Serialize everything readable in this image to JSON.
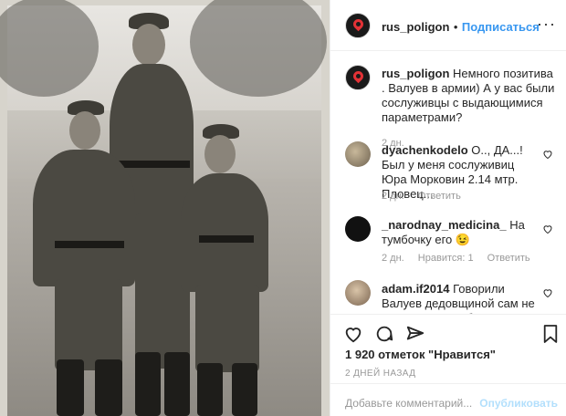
{
  "post": {
    "author": "rus_poligon",
    "follow_label": "Подписаться",
    "separator": "•",
    "more_label": "···"
  },
  "caption": {
    "author": "rus_poligon",
    "text": "Немного позитива . Валуев в армии) А у вас были сослуживцы с выдающимися параметрами?",
    "time": "2 дн."
  },
  "comments": [
    {
      "author": "dyachenkodelo",
      "text": "О.., ДА...! Был у меня сослуживиц Юра Морковин 2.14 мтр. Пловец...",
      "time": "2 дн.",
      "reply": "Ответить",
      "likes": ""
    },
    {
      "author": "_narodnay_medicina_",
      "text": "На тумбочку его 😉",
      "time": "2 дн.",
      "reply": "Ответить",
      "likes": "Нравится: 1"
    },
    {
      "author": "adam.if2014",
      "text": "Говорили Валуев дедовщиной сам не страдал, и не обижал молодых",
      "time": "",
      "reply": "",
      "likes": ""
    }
  ],
  "stats": {
    "likes": "1 920 отметок \"Нравится\"",
    "posted": "2 ДНЕЙ НАЗАД"
  },
  "comment_box": {
    "placeholder": "Добавьте комментарий...",
    "publish": "Опубликовать"
  },
  "icons": {
    "like": "heart-icon",
    "comment": "comment-icon",
    "share": "share-icon",
    "save": "bookmark-icon"
  },
  "colors": {
    "link": "#3897f0",
    "publish_disabled": "#b2dffc",
    "muted": "#999999"
  }
}
